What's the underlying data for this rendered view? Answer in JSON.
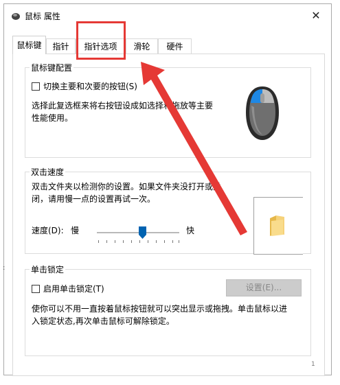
{
  "window": {
    "title": "鼠标 属性",
    "close_glyph": "✕"
  },
  "tabs": [
    {
      "label": "鼠标键"
    },
    {
      "label": "指针"
    },
    {
      "label": "指针选项"
    },
    {
      "label": "滑轮"
    },
    {
      "label": "硬件"
    }
  ],
  "button_config": {
    "group_title": "鼠标键配置",
    "switch_checkbox_label": "切换主要和次要的按钮(S)",
    "description_line1": "选择此复选框来将右按钮设成如选择和拖放等主要",
    "description_line2": "性能使用。"
  },
  "double_click": {
    "group_title": "双击速度",
    "description_line1": "双击文件夹以检测你的设置。如果文件夹没打开或关",
    "description_line2": "闭，请用慢一点的设置再试一次。",
    "speed_label": "速度(D):",
    "slow_label": "慢",
    "fast_label": "快",
    "speed_value": 0.55
  },
  "click_lock": {
    "group_title": "单击锁定",
    "checkbox_label": "启用单击锁定(T)",
    "settings_button": "设置(E)...",
    "description_line1": "使你可以不用一直按着鼠标按钮就可以突出显示或拖拽。单击鼠标以进",
    "description_line2": "入锁定状态,再次单击鼠标可解除锁定。"
  },
  "footer_glyph": "1",
  "edge_dots": ":",
  "colors": {
    "highlight_box": "#e53935",
    "arrow": "#e53935",
    "mouse_accent": "#1e88e5"
  }
}
